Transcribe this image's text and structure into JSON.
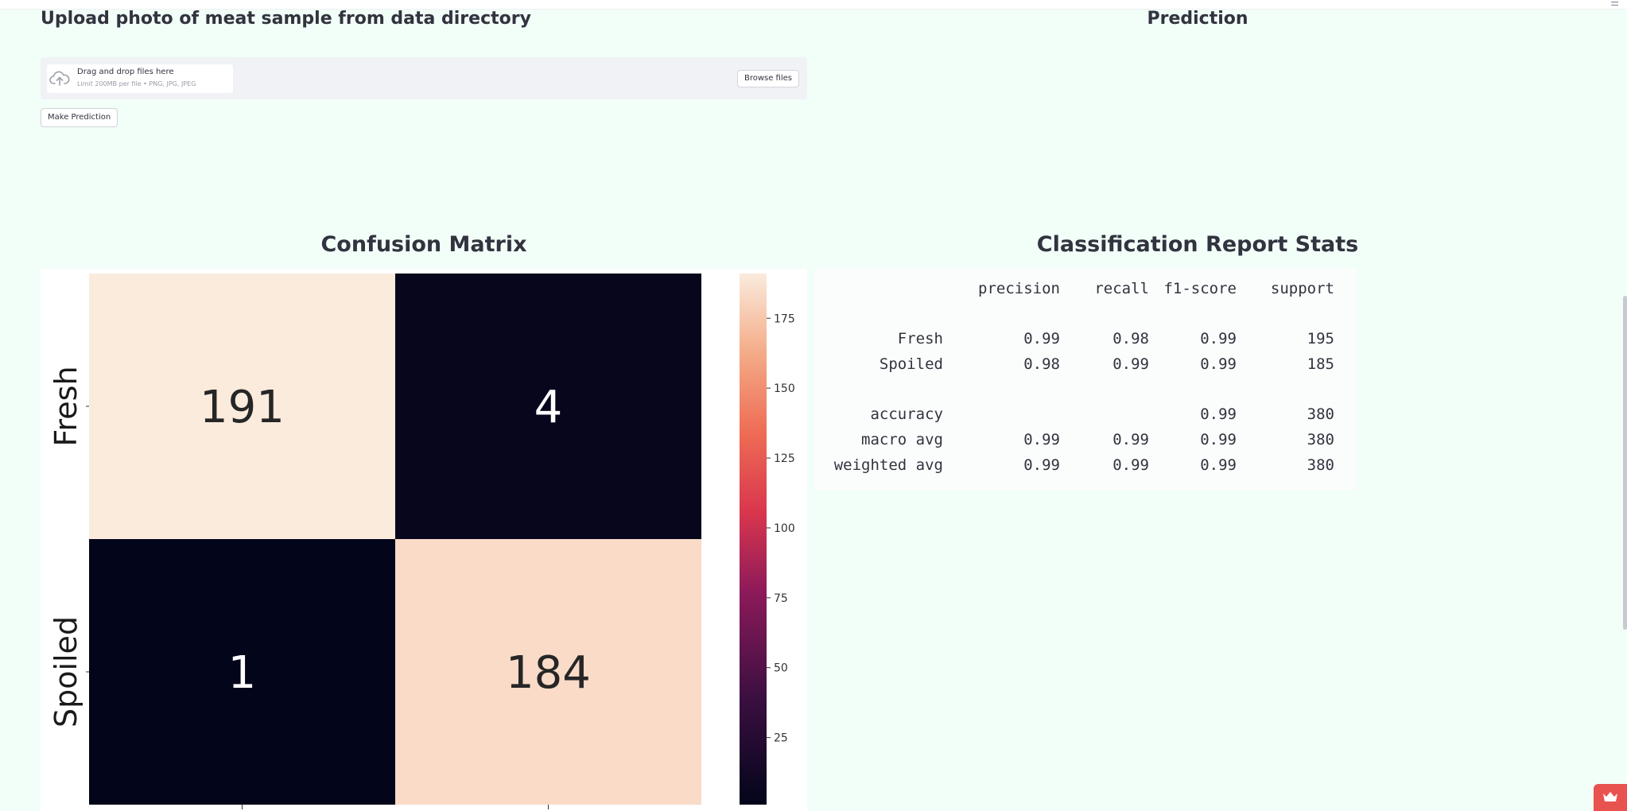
{
  "upload_section": {
    "heading": "Upload photo of meat sample from data directory",
    "drag_text": "Drag and drop files here",
    "limit_text": "Limit 200MB per file • PNG, JPG, JPEG",
    "browse_label": "Browse files",
    "cloud_icon": "cloud-upload-icon"
  },
  "make_prediction_label": "Make Prediction",
  "prediction_heading": "Prediction",
  "confusion_matrix": {
    "heading": "Confusion Matrix"
  },
  "chart_data": {
    "type": "heatmap",
    "row_labels": [
      "Fresh",
      "Spoiled"
    ],
    "matrix": [
      [
        191,
        4
      ],
      [
        1,
        184
      ]
    ],
    "colorbar_ticks": [
      "175",
      "150",
      "125",
      "100",
      "75",
      "50",
      "25"
    ],
    "colorbar_tick_values": [
      175,
      150,
      125,
      100,
      75,
      50,
      25
    ],
    "colorbar_range": [
      1,
      191
    ],
    "colormap": "rocket",
    "grid": false
  },
  "classification_report": {
    "heading": "Classification Report Stats",
    "header": [
      "",
      "precision",
      "recall",
      "f1-score",
      "support"
    ],
    "rows": [
      [
        "Fresh",
        "0.99",
        "0.98",
        "0.99",
        "195"
      ],
      [
        "Spoiled",
        "0.98",
        "0.99",
        "0.99",
        "185"
      ],
      [
        "accuracy",
        "",
        "",
        "0.99",
        "380"
      ],
      [
        "macro avg",
        "0.99",
        "0.99",
        "0.99",
        "380"
      ],
      [
        "weighted avg",
        "0.99",
        "0.99",
        "0.99",
        "380"
      ]
    ]
  },
  "colors": {
    "page_background": "#f2fef8",
    "heatmap_high": "#f6e6da",
    "heatmap_low": "#0b0618",
    "corner_widget": "#e8534f"
  },
  "corner_widget_icon": "crown-icon",
  "menu_icon": "hamburger-icon"
}
